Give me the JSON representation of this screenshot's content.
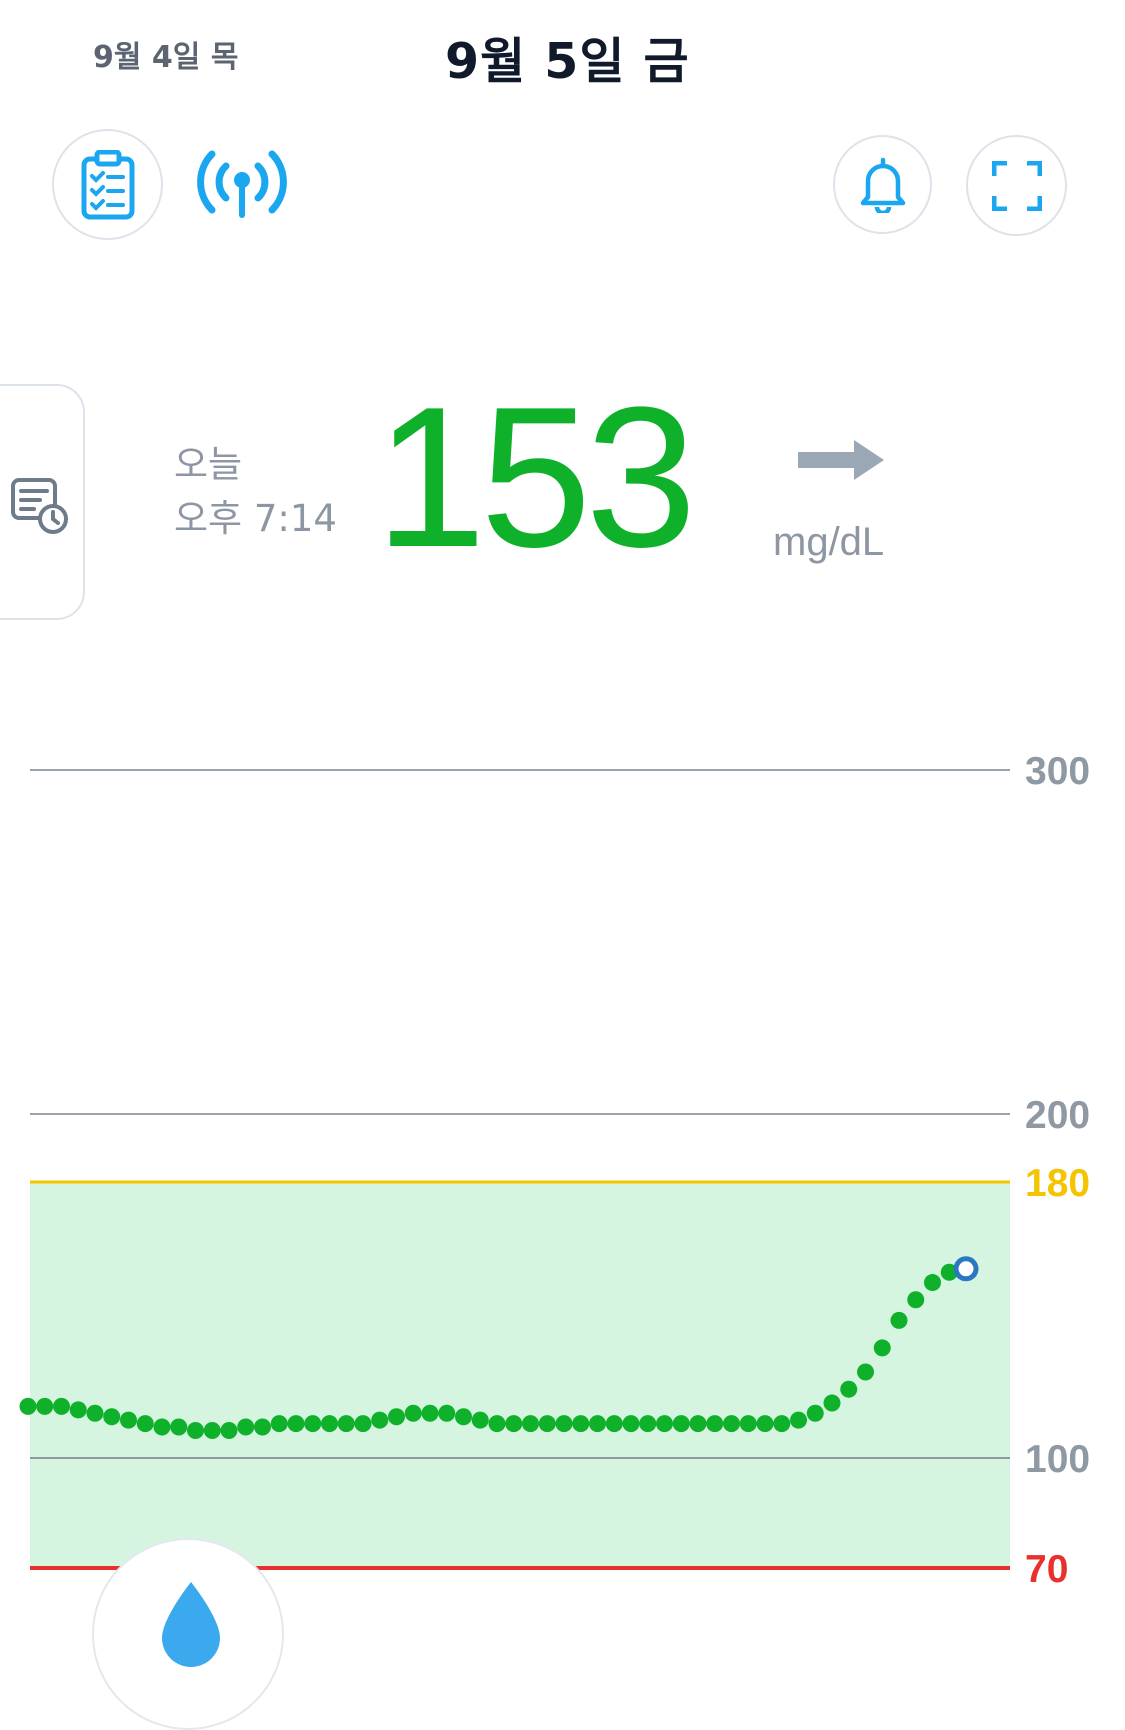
{
  "header": {
    "prev_date": "9월 4일 목",
    "current_date": "9월 5일 금"
  },
  "toolbar": {
    "log_icon": "clipboard-checklist-icon",
    "signal_icon": "sensor-signal-icon",
    "bell_icon": "bell-icon",
    "expand_icon": "expand-icon"
  },
  "side_tab": {
    "icon": "history-report-icon"
  },
  "reading": {
    "day": "오늘",
    "time": "오후 7:14",
    "value": "153",
    "unit": "mg/dL",
    "trend": "steady-right-arrow",
    "color": "#0fb12b"
  },
  "colors": {
    "in_range": "#0fb12b",
    "high_threshold": "#f5c400",
    "low_threshold": "#e8302c",
    "target_band": "#d6f5e1",
    "accent": "#1ba6f0",
    "latest_point": "#2a78c2"
  },
  "chart_data": {
    "type": "scatter",
    "y_ticks": [
      "300",
      "200",
      "180",
      "100",
      "70"
    ],
    "ylim": [
      70,
      300
    ],
    "target_range": [
      70,
      180
    ],
    "high_limit": 180,
    "low_limit": 70,
    "x_count": 57,
    "values": [
      115,
      115,
      115,
      114,
      113,
      112,
      111,
      110,
      109,
      109,
      108,
      108,
      108,
      109,
      109,
      110,
      110,
      110,
      110,
      110,
      110,
      111,
      112,
      113,
      113,
      113,
      112,
      111,
      110,
      110,
      110,
      110,
      110,
      110,
      110,
      110,
      110,
      110,
      110,
      110,
      110,
      110,
      110,
      110,
      110,
      110,
      111,
      113,
      116,
      120,
      125,
      132,
      140,
      146,
      151,
      154,
      155
    ],
    "latest_value": 153
  },
  "fab": {
    "icon": "blood-drop-icon"
  }
}
